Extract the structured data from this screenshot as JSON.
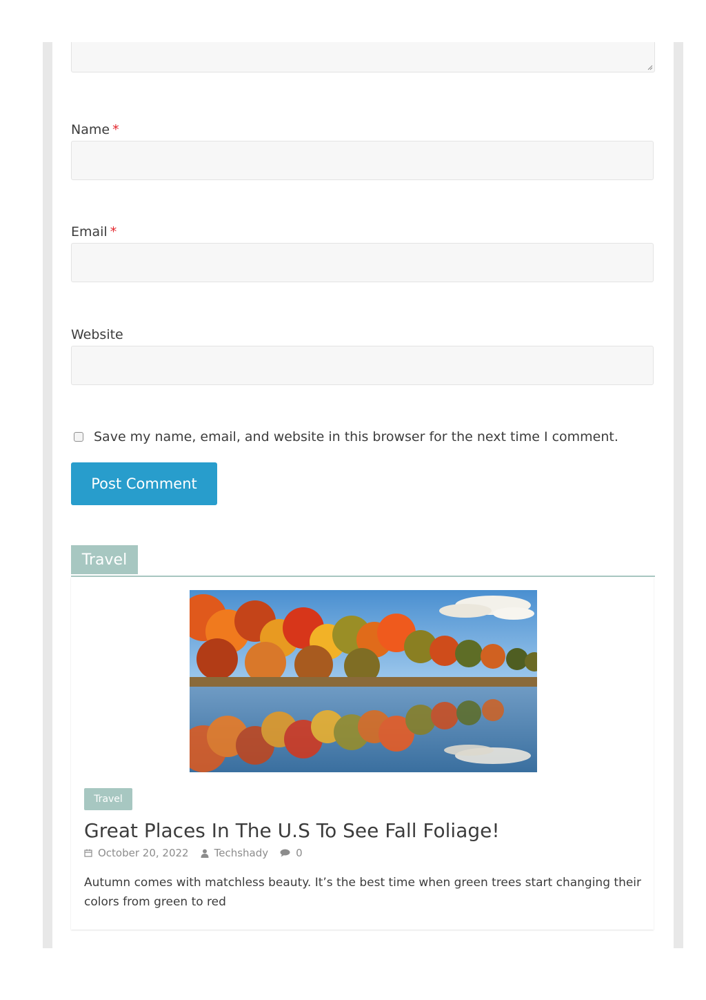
{
  "form": {
    "name": {
      "label": "Name",
      "required_mark": "*",
      "value": ""
    },
    "email": {
      "label": "Email",
      "required_mark": "*",
      "value": ""
    },
    "website": {
      "label": "Website",
      "value": ""
    },
    "consent": {
      "label": "Save my name, email, and website in this browser for the next time I comment.",
      "checked": false
    },
    "submit_label": "Post Comment"
  },
  "section": {
    "title": "Travel",
    "accent_color": "#a7c7c1"
  },
  "post": {
    "category": "Travel",
    "title": "Great Places In The U.S To See Fall Foliage!",
    "date": "October 20, 2022",
    "author": "Techshady",
    "comments": "0",
    "excerpt": "Autumn comes with matchless beauty. It’s the best time when green trees start changing their colors from green to red",
    "icons": {
      "date": "calendar-icon",
      "author": "user-icon",
      "comments": "comment-icon"
    }
  },
  "colors": {
    "button": "#289dcc",
    "required": "#e3242b"
  }
}
